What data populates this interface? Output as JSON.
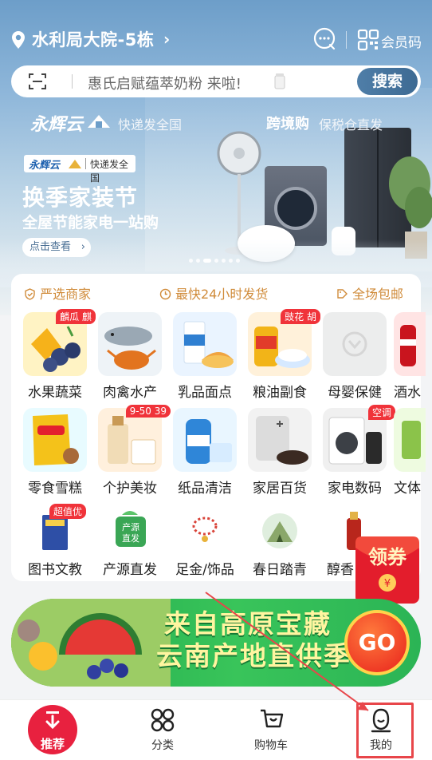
{
  "header": {
    "location": "水利局大院-5栋",
    "member_code_label": "会员码"
  },
  "search": {
    "placeholder": "惠氏启赋蕴萃奶粉 来啦!",
    "button_label": "搜索"
  },
  "banner": {
    "brand": "永辉云",
    "brand_tagline": "快递发全国",
    "cross_border": "跨境购",
    "cross_border_tagline": "保税仓直发",
    "chip_brand": "永辉云",
    "chip_text": "快递发全国",
    "title": "换季家装节",
    "subtitle": "全屋节能家电一站购",
    "cta": "点击查看",
    "carousel_count": 7,
    "carousel_active": 3
  },
  "service_tags": [
    "严选商家",
    "最快24小时发货",
    "全场包邮"
  ],
  "categories": {
    "row1": [
      {
        "label": "水果蔬菜",
        "badge": "麟瓜 麒"
      },
      {
        "label": "肉禽水产",
        "badge": ""
      },
      {
        "label": "乳品面点",
        "badge": ""
      },
      {
        "label": "粮油副食",
        "badge": "豉花 胡"
      },
      {
        "label": "母婴保健",
        "badge": ""
      },
      {
        "label": "酒水",
        "badge": ""
      }
    ],
    "row2": [
      {
        "label": "零食雪糕",
        "badge": ""
      },
      {
        "label": "个护美妆",
        "badge": "9-50 39"
      },
      {
        "label": "纸品清洁",
        "badge": ""
      },
      {
        "label": "家居百货",
        "badge": ""
      },
      {
        "label": "家电数码",
        "badge": "空调"
      },
      {
        "label": "文体",
        "badge": ""
      }
    ],
    "row3": [
      {
        "label": "图书文教",
        "badge": "超值优"
      },
      {
        "label": "产源直发",
        "badge": ""
      },
      {
        "label": "足金/饰品",
        "badge": ""
      },
      {
        "label": "春日踏青",
        "badge": ""
      },
      {
        "label": "醇香",
        "badge": ""
      }
    ]
  },
  "coupon": {
    "label": "领券"
  },
  "ad": {
    "line1": "来自高原宝藏",
    "line2": "云南产地直供季",
    "go": "GO"
  },
  "tabbar": {
    "home": "推荐",
    "category": "分类",
    "cart": "购物车",
    "mine": "我的"
  },
  "colors": {
    "accent_red": "#e8213f",
    "tag_orange": "#d08b3a",
    "search_button": "#3d6a93",
    "highlight": "#e8464a"
  }
}
